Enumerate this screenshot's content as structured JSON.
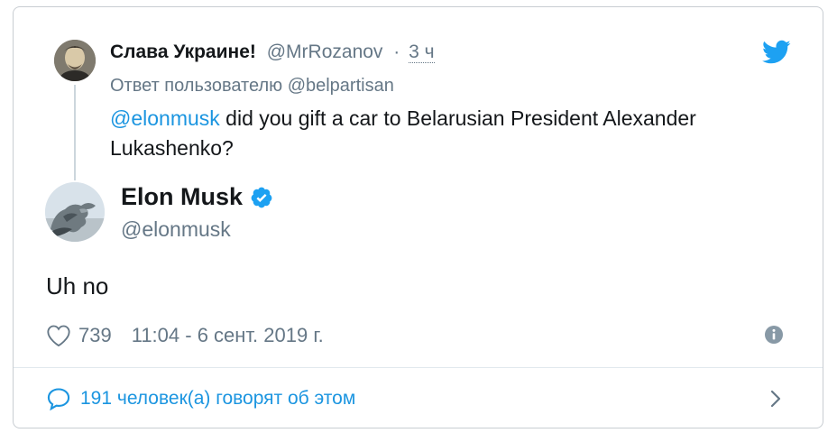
{
  "parent_tweet": {
    "display_name": "Слава Украине!",
    "handle": "@MrRozanov",
    "separator": "·",
    "time": "3 ч",
    "reply_prefix": "Ответ пользователю",
    "reply_handle": "@belpartisan",
    "mention": "@elonmusk",
    "text": " did you gift a car to Belarusian President Alexander Lukashenko?"
  },
  "main_tweet": {
    "display_name": "Elon Musk",
    "handle": "@elonmusk",
    "text": "Uh no",
    "like_count": "739",
    "timestamp": "11:04 - 6 сент. 2019 г."
  },
  "footer": {
    "conversation": "191 человек(а) говорят об этом"
  },
  "colors": {
    "link": "#1b95e0",
    "secondary": "#657786",
    "border": "#c8cdd2"
  },
  "icons": [
    "twitter-bird-icon",
    "verified-badge-icon",
    "heart-icon",
    "info-icon",
    "comment-icon",
    "chevron-right-icon"
  ]
}
